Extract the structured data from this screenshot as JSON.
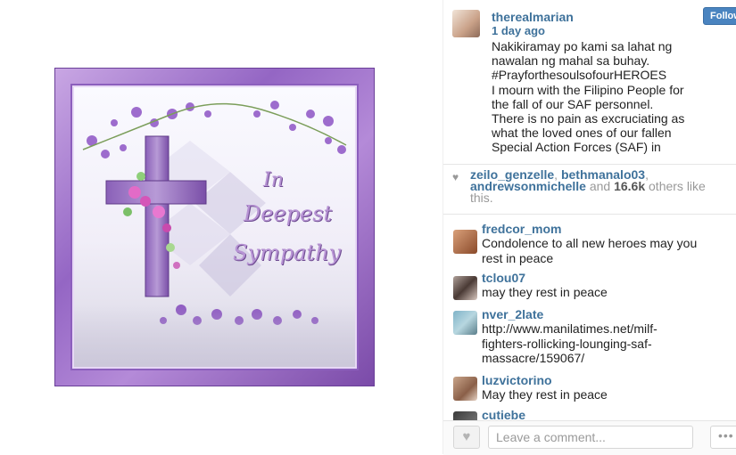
{
  "media": {
    "card_text_line1": "In",
    "card_text_line2": "Deepest",
    "card_text_line3": "Sympathy",
    "frame_color": "#9466c4"
  },
  "post": {
    "username": "therealmarian",
    "time": "1 day ago",
    "follow_label": "Follow",
    "caption_lines": [
      "Nakikiramay po kami sa lahat ng",
      "nawalan ng mahal sa buhay.",
      "#PrayforthesoulsofourHEROES",
      "I mourn with the Filipino People for",
      "the fall of our SAF personnel.",
      "There is no pain as excruciating as",
      "what the loved ones of our fallen",
      "Special Action Forces (SAF) in"
    ]
  },
  "likes": {
    "user1": "zeilo_genzelle",
    "user2": "bethmanalo03",
    "user3": "andrewsonmichelle",
    "and_word": "and",
    "count": "16.6k",
    "suffix1": "others like",
    "suffix2": "this."
  },
  "comments": [
    {
      "user": "fredcor_mom",
      "text_lines": [
        "Condolence to all new heroes may you",
        "rest in peace"
      ]
    },
    {
      "user": "tclou07",
      "text_lines": [
        "may they rest in peace"
      ]
    },
    {
      "user": "nver_2late",
      "text_lines": [
        "http://www.manilatimes.net/milf-",
        "fighters-rollicking-lounging-saf-",
        "massacre/159067/"
      ]
    },
    {
      "user": "luzvictorino",
      "text_lines": [
        "May they rest in peace"
      ]
    },
    {
      "user": "cutiebe",
      "text_lines": []
    }
  ],
  "bottom": {
    "comment_placeholder": "Leave a comment...",
    "more_label": "•••",
    "like_icon": "heart-icon"
  },
  "colors": {
    "username_blue": "#3f729b",
    "follow_blue": "#4a84c0"
  }
}
